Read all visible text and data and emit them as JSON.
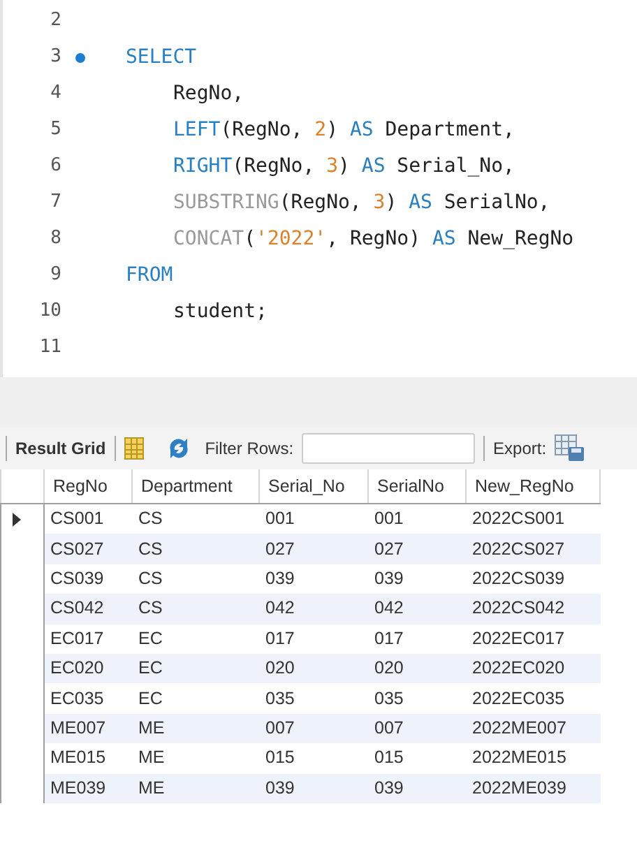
{
  "editor": {
    "lines": [
      {
        "number": "2",
        "breakpoint": false
      },
      {
        "number": "3",
        "breakpoint": true,
        "indented": false,
        "tokens": [
          {
            "kind": "keyword",
            "text": "SELECT"
          }
        ]
      },
      {
        "number": "4",
        "breakpoint": false,
        "indented": true,
        "tokens": [
          {
            "kind": "plain",
            "text": "RegNo,"
          }
        ]
      },
      {
        "number": "5",
        "breakpoint": false,
        "indented": true,
        "tokens": [
          {
            "kind": "keyword",
            "text": "LEFT"
          },
          {
            "kind": "plain",
            "text": "(RegNo, "
          },
          {
            "kind": "number",
            "text": "2"
          },
          {
            "kind": "plain",
            "text": ") "
          },
          {
            "kind": "keyword",
            "text": "AS"
          },
          {
            "kind": "plain",
            "text": " Department,"
          }
        ]
      },
      {
        "number": "6",
        "breakpoint": false,
        "indented": true,
        "tokens": [
          {
            "kind": "keyword",
            "text": "RIGHT"
          },
          {
            "kind": "plain",
            "text": "(RegNo, "
          },
          {
            "kind": "number",
            "text": "3"
          },
          {
            "kind": "plain",
            "text": ") "
          },
          {
            "kind": "keyword",
            "text": "AS"
          },
          {
            "kind": "plain",
            "text": " Serial_No,"
          }
        ]
      },
      {
        "number": "7",
        "breakpoint": false,
        "indented": true,
        "tokens": [
          {
            "kind": "function",
            "text": "SUBSTRING"
          },
          {
            "kind": "plain",
            "text": "(RegNo, "
          },
          {
            "kind": "number",
            "text": "3"
          },
          {
            "kind": "plain",
            "text": ") "
          },
          {
            "kind": "keyword",
            "text": "AS"
          },
          {
            "kind": "plain",
            "text": " SerialNo,"
          }
        ]
      },
      {
        "number": "8",
        "breakpoint": false,
        "indented": true,
        "tokens": [
          {
            "kind": "function",
            "text": "CONCAT"
          },
          {
            "kind": "plain",
            "text": "("
          },
          {
            "kind": "number",
            "text": "'2022'"
          },
          {
            "kind": "plain",
            "text": ", RegNo) "
          },
          {
            "kind": "keyword",
            "text": "AS"
          },
          {
            "kind": "plain",
            "text": " New_RegNo"
          }
        ]
      },
      {
        "number": "9",
        "breakpoint": false,
        "indented": false,
        "tokens": [
          {
            "kind": "keyword",
            "text": "FROM"
          }
        ]
      },
      {
        "number": "10",
        "breakpoint": false,
        "indented": true,
        "tokens": [
          {
            "kind": "plain",
            "text": "student;"
          }
        ]
      },
      {
        "number": "11",
        "breakpoint": false
      }
    ]
  },
  "toolbar": {
    "result_grid": "Result Grid",
    "filter_label": "Filter Rows:",
    "export_label": "Export:"
  },
  "table": {
    "columns": [
      "RegNo",
      "Department",
      "Serial_No",
      "SerialNo",
      "New_RegNo"
    ],
    "rows": [
      {
        "selected": true,
        "cells": [
          "CS001",
          "CS",
          "001",
          "001",
          "2022CS001"
        ]
      },
      {
        "selected": false,
        "cells": [
          "CS027",
          "CS",
          "027",
          "027",
          "2022CS027"
        ]
      },
      {
        "selected": false,
        "cells": [
          "CS039",
          "CS",
          "039",
          "039",
          "2022CS039"
        ]
      },
      {
        "selected": false,
        "cells": [
          "CS042",
          "CS",
          "042",
          "042",
          "2022CS042"
        ]
      },
      {
        "selected": false,
        "cells": [
          "EC017",
          "EC",
          "017",
          "017",
          "2022EC017"
        ]
      },
      {
        "selected": false,
        "cells": [
          "EC020",
          "EC",
          "020",
          "020",
          "2022EC020"
        ]
      },
      {
        "selected": false,
        "cells": [
          "EC035",
          "EC",
          "035",
          "035",
          "2022EC035"
        ]
      },
      {
        "selected": false,
        "cells": [
          "ME007",
          "ME",
          "007",
          "007",
          "2022ME007"
        ]
      },
      {
        "selected": false,
        "cells": [
          "ME015",
          "ME",
          "015",
          "015",
          "2022ME015"
        ]
      },
      {
        "selected": false,
        "cells": [
          "ME039",
          "ME",
          "039",
          "039",
          "2022ME039"
        ]
      }
    ]
  }
}
